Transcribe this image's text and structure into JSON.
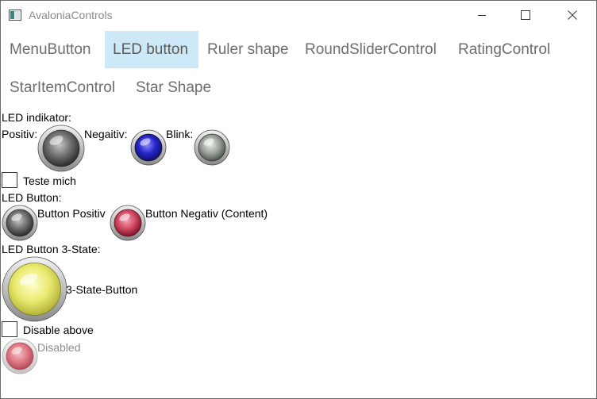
{
  "window": {
    "title": "AvaloniaControls",
    "controls": [
      "minimize-icon",
      "maximize-icon",
      "close-icon"
    ]
  },
  "tabs": [
    {
      "label": "MenuButton",
      "selected": false
    },
    {
      "label": "LED button",
      "selected": true
    },
    {
      "label": "Ruler shape",
      "selected": false
    },
    {
      "label": "RoundSliderControl",
      "selected": false
    },
    {
      "label": "RatingControl",
      "selected": false
    },
    {
      "label": "StarItemControl",
      "selected": false
    },
    {
      "label": "Star Shape",
      "selected": false
    }
  ],
  "led_indicator": {
    "heading": "LED indikator:",
    "positive_label": "Positiv:",
    "negative_label": "Negaitiv:",
    "blink_label": "Blink:"
  },
  "test_checkbox": {
    "label": "Teste mich",
    "checked": false
  },
  "led_button": {
    "heading": "LED Button:",
    "positive_label": "Button Positiv",
    "negative_label": "Button Negativ (Content)"
  },
  "led_3state": {
    "heading": "LED Button 3-State:",
    "button_label": "3-State-Button"
  },
  "disable_checkbox": {
    "label": "Disable above",
    "checked": false
  },
  "disabled_led": {
    "label": "Disabled"
  },
  "colors": {
    "tab_selected_bg": "#cde8f6",
    "led_off": "#7a7a7a",
    "led_blue": "#3030d0",
    "led_blink": "#a8b0a8",
    "led_red": "#d04060",
    "led_yellow": "#ecec6a",
    "led_disabled": "#e07a86"
  }
}
